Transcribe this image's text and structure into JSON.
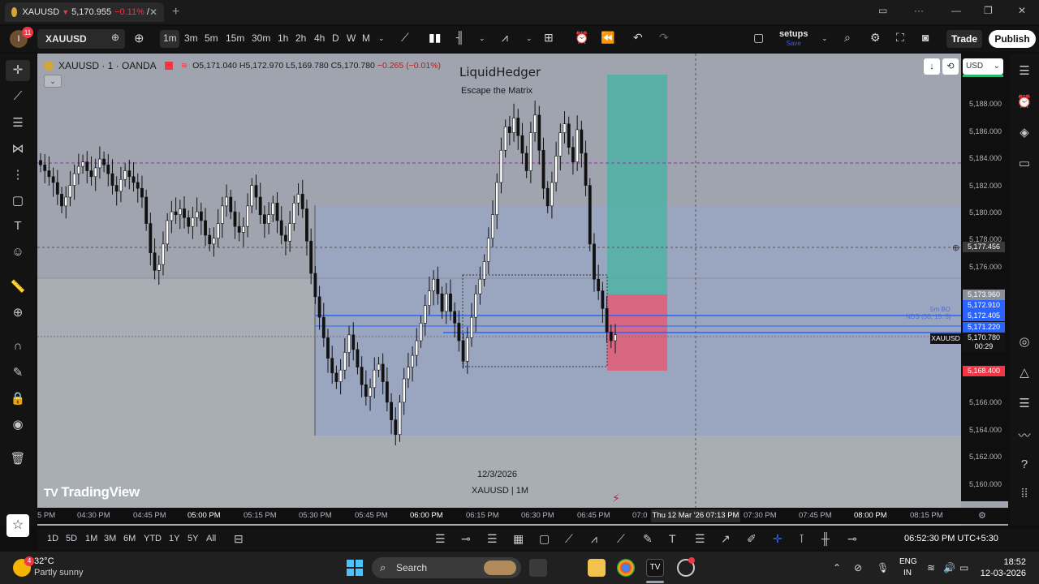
{
  "browser": {
    "tab_symbol": "XAUUSD",
    "tab_price": "5,170.955",
    "tab_change": "−0.11%",
    "tab_suffix": "/",
    "new_tab": "+"
  },
  "toolbar": {
    "avatar_letter": "I",
    "notifications": "11",
    "symbol": "XAUUSD",
    "timeframes": [
      "1m",
      "3m",
      "5m",
      "15m",
      "30m",
      "1h",
      "2h",
      "4h",
      "D",
      "W",
      "M"
    ],
    "active_timeframe": "1m",
    "setups_label": "setups",
    "setups_sub": "Save",
    "trade_label": "Trade",
    "publish_label": "Publish"
  },
  "chart": {
    "legend_title": "XAUUSD · 1 · OANDA",
    "legend_o": "O5,171.040",
    "legend_h": "H5,172.970",
    "legend_l": "L5,169.780",
    "legend_c": "C5,170.780",
    "legend_chg": "−0.265 (−0.01%)",
    "watermark_title": "LiquidHedger",
    "watermark_sub": "Escape the Matrix",
    "watermark_date": "12/3/2026",
    "watermark_symbol": "XAUUSD | 1M",
    "logo_text": "TradingView",
    "currency": "USD",
    "price_ticks": [
      "5,188.000",
      "5,186.000",
      "5,184.000",
      "5,182.000",
      "5,180.000",
      "5,178.000",
      "5,176.000",
      "5,166.000",
      "5,164.000",
      "5,162.000",
      "5,160.000"
    ],
    "price_labels": {
      "crosshair": "5,177.456",
      "level1": "5,173.960",
      "level2": "5,172.910",
      "level3": "5,172.405",
      "level4": "5,171.220",
      "current": "5,170.780",
      "countdown": "00:29",
      "stop": "5,168.400",
      "symbol_tag": "XAUUSD"
    },
    "indicator_labels": [
      "5m BO",
      "NDS (30, 15, 5)"
    ],
    "time_ticks": [
      "5 PM",
      "04:30 PM",
      "04:45 PM",
      "05:00 PM",
      "05:15 PM",
      "05:30 PM",
      "05:45 PM",
      "06:00 PM",
      "06:15 PM",
      "06:30 PM",
      "06:45 PM",
      "07:0",
      "07:30 PM",
      "07:45 PM",
      "08:00 PM",
      "08:15 PM"
    ],
    "time_crosshair": "Thu 12 Mar '26   07:13 PM"
  },
  "chart_data": {
    "type": "candlestick",
    "title": "XAUUSD · 1 · OANDA",
    "ylim": [
      5159,
      5190
    ],
    "x_start": "04:20 PM",
    "x_end": "08:20 PM",
    "candle_interval": "1m",
    "closes": [
      5182.4,
      5182.0,
      5181.6,
      5181.2,
      5180.4,
      5179.6,
      5180.2,
      5181.0,
      5181.8,
      5182.3,
      5182.6,
      5182.0,
      5181.6,
      5182.2,
      5182.8,
      5182.4,
      5181.8,
      5181.0,
      5180.6,
      5181.4,
      5182.0,
      5181.6,
      5181.2,
      5180.8,
      5180.2,
      5178.4,
      5176.4,
      5175.2,
      5175.6,
      5177.0,
      5178.6,
      5179.2,
      5179.0,
      5179.4,
      5178.8,
      5178.2,
      5178.8,
      5179.2,
      5178.6,
      5177.6,
      5177.0,
      5177.4,
      5178.4,
      5179.6,
      5180.2,
      5179.2,
      5178.2,
      5177.8,
      5178.2,
      5179.6,
      5181.0,
      5180.2,
      5179.0,
      5178.4,
      5179.0,
      5179.8,
      5178.6,
      5177.6,
      5177.2,
      5178.4,
      5179.8,
      5180.4,
      5179.4,
      5177.2,
      5175.0,
      5173.4,
      5172.0,
      5170.6,
      5169.2,
      5168.2,
      5167.6,
      5168.4,
      5169.6,
      5170.8,
      5169.8,
      5168.6,
      5167.4,
      5166.6,
      5167.2,
      5168.4,
      5168.8,
      5167.6,
      5166.2,
      5165.0,
      5164.0,
      5166.2,
      5167.8,
      5168.6,
      5169.4,
      5170.4,
      5171.6,
      5172.8,
      5173.8,
      5174.6,
      5173.6,
      5172.4,
      5173.6,
      5172.4,
      5171.6,
      5170.4,
      5169.0,
      5170.6,
      5172.0,
      5173.6,
      5174.6,
      5175.8,
      5177.4,
      5179.0,
      5181.2,
      5183.4,
      5185.0,
      5184.6,
      5185.6,
      5184.4,
      5183.2,
      5182.0,
      5184.6,
      5185.8,
      5183.4,
      5180.8,
      5179.6,
      5181.2,
      5183.0,
      5184.6,
      5185.2,
      5183.6,
      5182.6,
      5184.8,
      5183.2,
      5181.0,
      5177.0,
      5174.6,
      5173.8,
      5172.6,
      5171.0,
      5170.4,
      5170.8
    ]
  },
  "bottom_bar": {
    "ranges": [
      "1D",
      "5D",
      "1M",
      "3M",
      "6M",
      "YTD",
      "1Y",
      "5Y",
      "All"
    ],
    "clock": "06:52:30 PM UTC+5:30"
  },
  "taskbar": {
    "temperature": "32°C",
    "weather": "Partly sunny",
    "weather_badge": "4",
    "search_label": "Search",
    "lang_top": "ENG",
    "lang_bottom": "IN",
    "time": "18:52",
    "date": "12-03-2026"
  },
  "colors": {
    "chart_bg": "#a0a4ae",
    "upper_zone": "#9aa6bf",
    "lower_zone": "#a9adb4",
    "target_zone": "#4db3a6",
    "stop_zone": "#e0607a",
    "blue_line": "#2962ff",
    "purple_line": "#9c27b0",
    "accent_red": "#f23645"
  }
}
